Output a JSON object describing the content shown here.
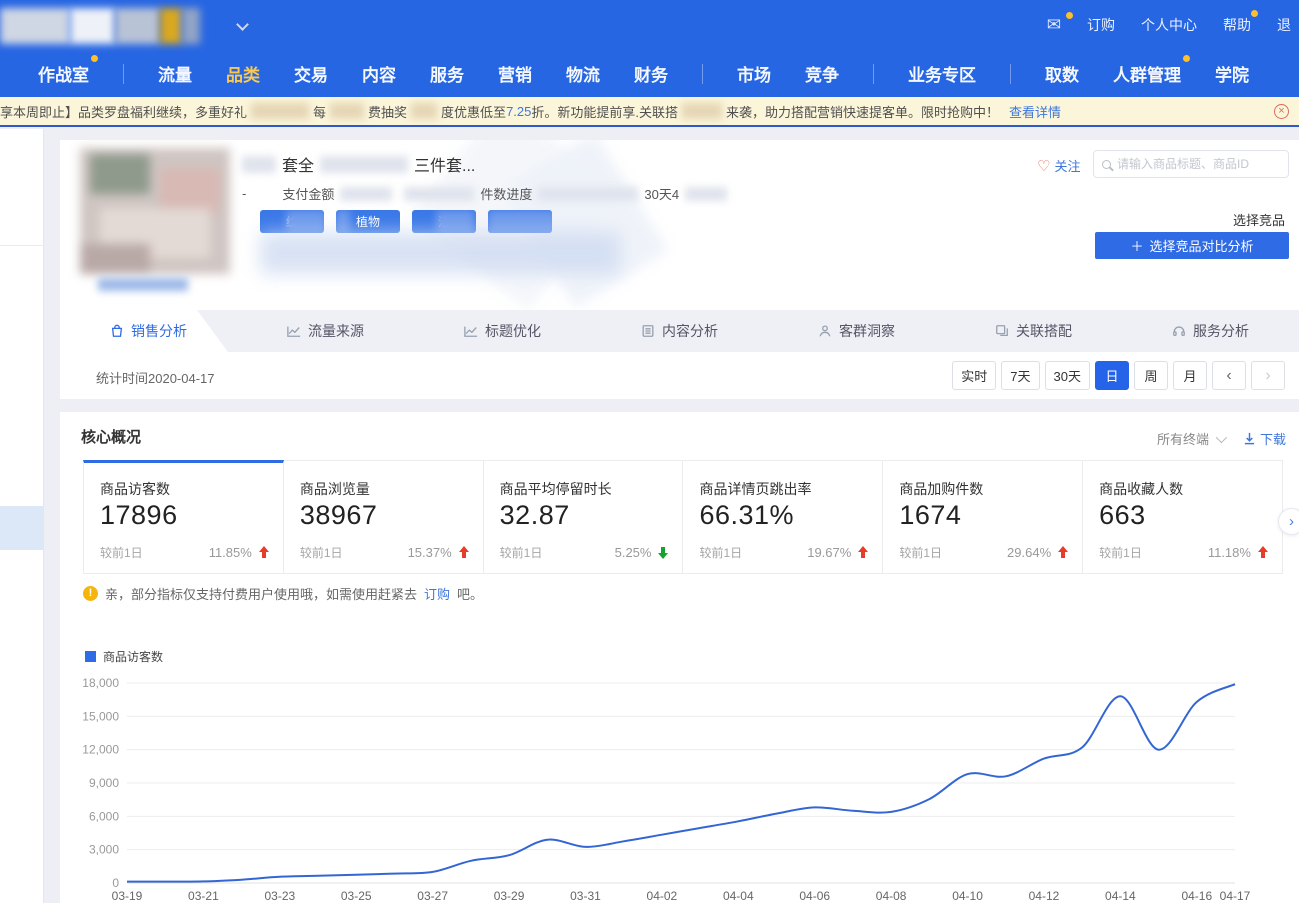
{
  "colors": {
    "topbar": "#2766e3",
    "accent": "#2f6be4",
    "active_nav": "#f9c851",
    "banner_bg": "#fbf5da",
    "line": "#3366d4",
    "up": "#e73c28",
    "down": "#13a42c"
  },
  "topbar": {
    "account": [
      {
        "label": "订购",
        "dot": false
      },
      {
        "label": "个人中心",
        "dot": false
      },
      {
        "label": "帮助",
        "dot": true
      },
      {
        "label": "退",
        "dot": false
      }
    ],
    "nav": [
      {
        "label": "作战室",
        "dot": true
      },
      {
        "label": "流量"
      },
      {
        "label": "品类",
        "active": true
      },
      {
        "label": "交易"
      },
      {
        "label": "内容"
      },
      {
        "label": "服务"
      },
      {
        "label": "营销"
      },
      {
        "label": "物流"
      },
      {
        "label": "财务"
      },
      {
        "label": "市场"
      },
      {
        "label": "竞争"
      },
      {
        "label": "业务专区"
      },
      {
        "label": "取数"
      },
      {
        "label": "人群管理",
        "dot": true
      },
      {
        "label": "学院"
      }
    ]
  },
  "banner": {
    "seg1": "享本周即止】品类罗盘福利继续，多重好礼",
    "seg2": "每",
    "seg3": "费抽奖",
    "seg4": "度优惠低至",
    "discount": "7.25",
    "seg5": "折。新功能提前享.关联搭",
    "seg6": "来袭，助力搭配营销快速提客单。限时抢购中！",
    "link": "查看详情",
    "close": "×"
  },
  "product": {
    "title_frag1": "套全",
    "title_frag2": "三件套...",
    "dash": "-",
    "pay_label": "支付金额",
    "progress_label": "件数进度",
    "days_label": "30天4",
    "tag_frag1": "纹",
    "tag_frag2": "植物",
    "tag_frag3": "洁",
    "follow": "关注",
    "heart": "♡",
    "search_placeholder": "请输入商品标题、商品ID",
    "select_competitor": "选择竞品",
    "compare_plus": "＋",
    "compare_button": "选择竞品对比分析"
  },
  "tabs": [
    {
      "label": "销售分析",
      "active": true
    },
    {
      "label": "流量来源"
    },
    {
      "label": "标题优化"
    },
    {
      "label": "内容分析"
    },
    {
      "label": "客群洞察"
    },
    {
      "label": "关联搭配"
    },
    {
      "label": "服务分析"
    }
  ],
  "timebar": {
    "stat_time": "统计时间2020-04-17",
    "ranges": [
      "实时",
      "7天",
      "30天",
      "日",
      "周",
      "月"
    ],
    "active_range": "日",
    "prev": "‹",
    "next": "›"
  },
  "core": {
    "title": "核心概况",
    "terminal": "所有终端",
    "download": "下载",
    "cards": [
      {
        "label": "商品访客数",
        "value": "17896",
        "compare": "较前1日",
        "change": "11.85%",
        "direction": "up"
      },
      {
        "label": "商品浏览量",
        "value": "38967",
        "compare": "较前1日",
        "change": "15.37%",
        "direction": "up"
      },
      {
        "label": "商品平均停留时长",
        "value": "32.87",
        "compare": "较前1日",
        "change": "5.25%",
        "direction": "down"
      },
      {
        "label": "商品详情页跳出率",
        "value": "66.31%",
        "compare": "较前1日",
        "change": "19.67%",
        "direction": "up"
      },
      {
        "label": "商品加购件数",
        "value": "1674",
        "compare": "较前1日",
        "change": "29.64%",
        "direction": "up"
      },
      {
        "label": "商品收藏人数",
        "value": "663",
        "compare": "较前1日",
        "change": "11.18%",
        "direction": "up"
      }
    ],
    "notice_pre": "亲，部分指标仅支持付费用户使用哦，如需使用赶紧去",
    "notice_link": "订购",
    "notice_post": "吧。"
  },
  "chart_data": {
    "type": "line",
    "title": "商品访客数",
    "legend": [
      "商品访客数"
    ],
    "xlabel": "",
    "ylabel": "",
    "ylim": [
      0,
      18000
    ],
    "yticks": [
      0,
      3000,
      6000,
      9000,
      12000,
      15000,
      18000
    ],
    "grid": true,
    "legend_position": "top-left",
    "dates": [
      "03-19",
      "03-20",
      "03-21",
      "03-22",
      "03-23",
      "03-24",
      "03-25",
      "03-26",
      "03-27",
      "03-28",
      "03-29",
      "03-30",
      "03-31",
      "04-01",
      "04-02",
      "04-03",
      "04-04",
      "04-05",
      "04-06",
      "04-07",
      "04-08",
      "04-09",
      "04-10",
      "04-11",
      "04-12",
      "04-13",
      "04-14",
      "04-15",
      "04-16",
      "04-17"
    ],
    "values": [
      120,
      130,
      140,
      300,
      560,
      650,
      750,
      850,
      1000,
      2000,
      2500,
      3900,
      3250,
      3750,
      4350,
      4950,
      5550,
      6250,
      6800,
      6500,
      6400,
      7550,
      9800,
      9600,
      11200,
      12200,
      16800,
      12000,
      16300,
      17896
    ],
    "x_ticks": [
      "03-19",
      "03-21",
      "03-23",
      "03-25",
      "03-27",
      "03-29",
      "03-31",
      "04-02",
      "04-04",
      "04-06",
      "04-08",
      "04-10",
      "04-12",
      "04-14",
      "04-16",
      "04-17"
    ]
  }
}
